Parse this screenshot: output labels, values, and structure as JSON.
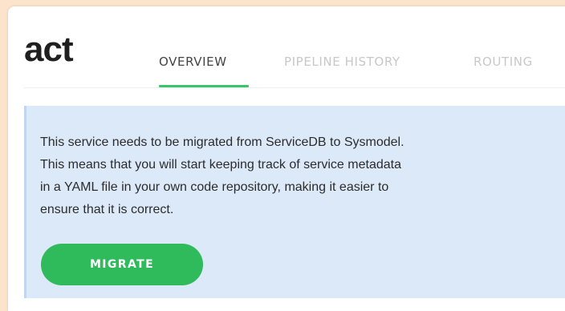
{
  "header": {
    "title": "act",
    "tabs": [
      {
        "label": "OVERVIEW",
        "active": true
      },
      {
        "label": "PIPELINE HISTORY",
        "active": false
      },
      {
        "label": "ROUTING",
        "active": false
      }
    ]
  },
  "banner": {
    "lines": [
      "This service needs to be migrated from ServiceDB to Sysmodel.",
      "This means that you will start keeping track of service metadata",
      "in a YAML file in your own code repository, making it easier to",
      "ensure that it is correct."
    ],
    "button_label": "MIGRATE"
  },
  "colors": {
    "accent_green": "#2fba5b",
    "tab_underline": "#37c76b",
    "banner_bg": "#dce9f8",
    "outer_bg": "#fbe3cc"
  }
}
